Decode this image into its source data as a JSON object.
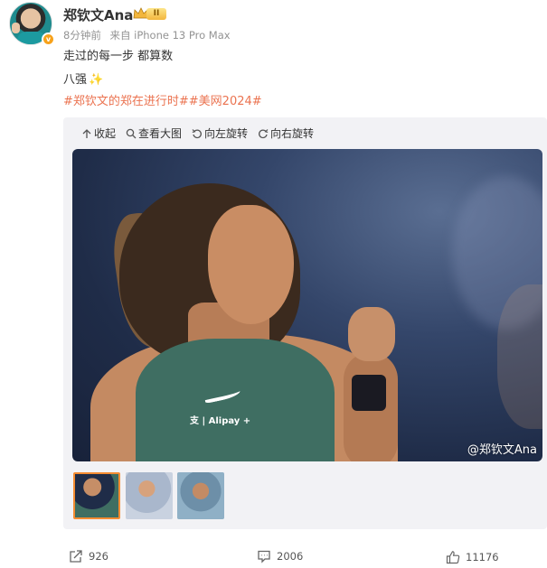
{
  "post": {
    "author": "郑钦文Ana",
    "level_badge": "II",
    "verified_mark": "v",
    "time": "8分钟前",
    "source": "来自 iPhone 13 Pro Max",
    "text_line1": "走过的每一步 都算数",
    "text_line2": "八强",
    "tags": "#郑钦文的郑在进行时##美网2024#"
  },
  "toolbar": {
    "collapse": "收起",
    "view_large": "查看大图",
    "rotate_left": "向左旋转",
    "rotate_right": "向右旋转"
  },
  "photo": {
    "watermark": "@郑钦文Ana",
    "jersey_text": "支 | Alipay +"
  },
  "actions": {
    "share_count": "926",
    "comment_count": "2006",
    "like_count": "11176"
  },
  "colors": {
    "tag_orange": "#eb7350",
    "selected_thumb_border": "#f48c32",
    "level_badge_gold": "#f3b63d"
  }
}
